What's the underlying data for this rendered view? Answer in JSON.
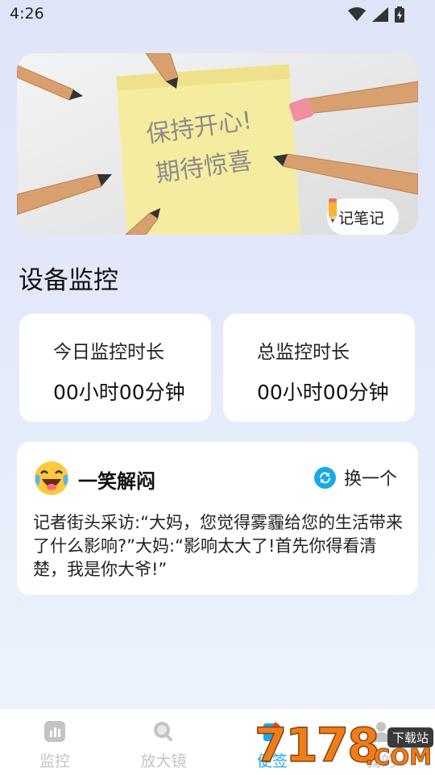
{
  "status_bar": {
    "time": "4:26",
    "icons": [
      "wifi-icon",
      "cellular-signal-icon",
      "battery-charging-icon"
    ]
  },
  "banner": {
    "image_text_line1": "保持开心!",
    "image_text_line2": "期待惊喜",
    "note_button_label": "记笔记"
  },
  "monitor": {
    "section_title": "设备监控",
    "today_label": "今日监控时长",
    "today_value": "00小时00分钟",
    "total_label": "总监控时长",
    "total_value": "00小时00分钟"
  },
  "joke": {
    "title": "一笑解闷",
    "refresh_label": "换一个",
    "text": "记者街头采访:“大妈，您觉得雾霾给您的生活带来了什么影响?”大妈:“影响太大了!首先你得看清楚，我是你大爷!”"
  },
  "tabs": [
    {
      "label": "监控",
      "icon": "chart-icon",
      "active": false
    },
    {
      "label": "放大镜",
      "icon": "magnifier-icon",
      "active": false
    },
    {
      "label": "便签",
      "icon": "note-icon",
      "active": true
    },
    {
      "label": "我的",
      "icon": "user-icon",
      "active": false
    }
  ],
  "watermark": {
    "digits": "7178",
    "domain": ".COM",
    "tag": "下载站"
  },
  "colors": {
    "accent": "#1aa8e8",
    "tab_inactive": "#c4c4c4",
    "sticky_note": "#f6eca0"
  }
}
